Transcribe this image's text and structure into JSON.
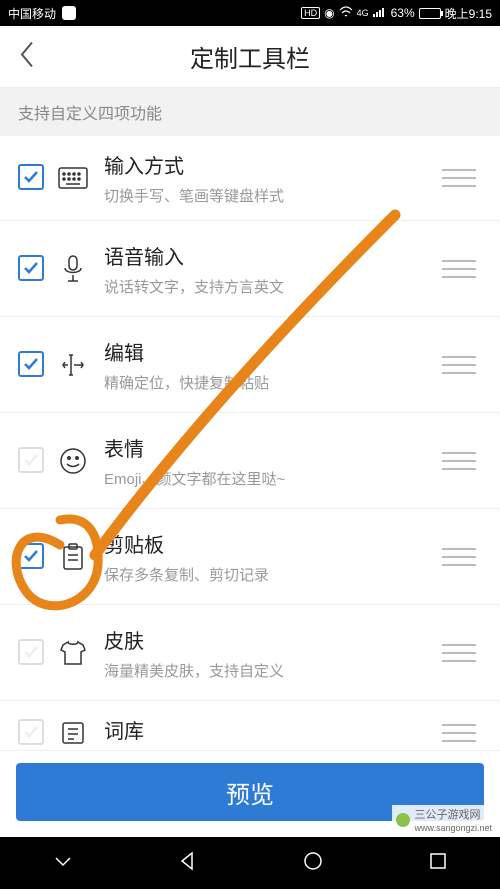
{
  "status": {
    "carrier": "中国移动",
    "hd": "HD",
    "net": "4G",
    "battery_pct": "63%",
    "time": "晚上9:15"
  },
  "header": {
    "title": "定制工具栏"
  },
  "subheader": "支持自定义四项功能",
  "rows": [
    {
      "icon": "keyboard-icon",
      "title": "输入方式",
      "sub": "切换手写、笔画等键盘样式",
      "checked": true
    },
    {
      "icon": "mic-icon",
      "title": "语音输入",
      "sub": "说话转文字，支持方言英文",
      "checked": true
    },
    {
      "icon": "cursor-icon",
      "title": "编辑",
      "sub": "精确定位，快捷复制粘贴",
      "checked": true
    },
    {
      "icon": "emoji-icon",
      "title": "表情",
      "sub": "Emoji、颜文字都在这里哒~",
      "checked": false
    },
    {
      "icon": "clipboard-icon",
      "title": "剪贴板",
      "sub": "保存多条复制、剪切记录",
      "checked": true
    },
    {
      "icon": "shirt-icon",
      "title": "皮肤",
      "sub": "海量精美皮肤，支持自定义",
      "checked": false
    },
    {
      "icon": "dict-icon",
      "title": "词库",
      "sub": "",
      "checked": false
    }
  ],
  "preview_button": "预览",
  "watermark": "三公子游戏网",
  "watermark_url": "www.sangongzi.net",
  "annotation": {
    "circle_row": 4,
    "line_from_row": 4,
    "line_to": "top-right",
    "color": "#e8851a"
  }
}
